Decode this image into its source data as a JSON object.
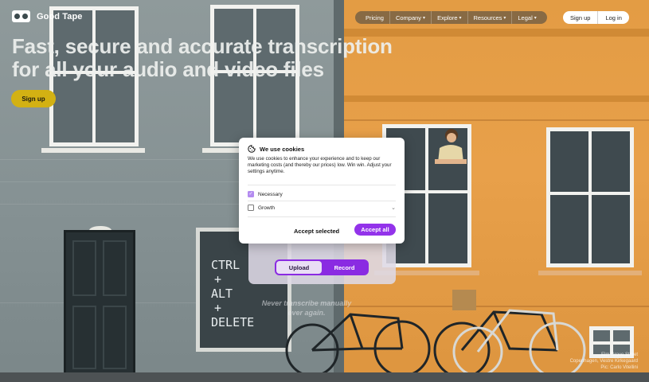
{
  "header": {
    "brand": "Good Tape",
    "nav": [
      {
        "label": "Pricing",
        "dropdown": false
      },
      {
        "label": "Company",
        "dropdown": true
      },
      {
        "label": "Explore",
        "dropdown": true
      },
      {
        "label": "Resources",
        "dropdown": true
      },
      {
        "label": "Legal",
        "dropdown": true
      }
    ],
    "signup_label": "Sign up",
    "login_label": "Log in"
  },
  "hero": {
    "line1": "Fast, secure and accurate transcription",
    "line2": "for all your audio and video files",
    "cta_label": "Sign up"
  },
  "upload_panel": {
    "tabs": [
      {
        "label": "Upload",
        "active": true
      },
      {
        "label": "Record",
        "active": false
      }
    ],
    "tagline_line1": "Never transcribe manually",
    "tagline_line2": "ever again."
  },
  "background": {
    "shop_window_text": [
      "CTRL",
      "+",
      "ALT",
      "+",
      "DELETE"
    ],
    "credit": [
      "Elm Grove Street",
      "Copenhagen, Vestre Kirkegaard",
      "Pic: Carlo Vitellini"
    ]
  },
  "cookie_dialog": {
    "title": "We use cookies",
    "body": "We use cookies to enhance your experience and to keep our marketing costs (and thereby our prices) low. Win win. Adjust your settings anytime.",
    "options": [
      {
        "label": "Necessary",
        "checked": true
      },
      {
        "label": "Growth",
        "checked": false
      }
    ],
    "accept_selected_label": "Accept selected",
    "accept_all_label": "Accept all"
  },
  "colors": {
    "accent_purple": "#9333ea",
    "signup_yellow": "#d3b113",
    "building_orange": "#e8a04a",
    "building_grey": "#8a9698"
  },
  "icons": {
    "logo": "cassette-tape-icon",
    "cookie": "cookie-icon",
    "dropdown": "chevron-down-icon",
    "expand": "chevron-down-icon"
  }
}
